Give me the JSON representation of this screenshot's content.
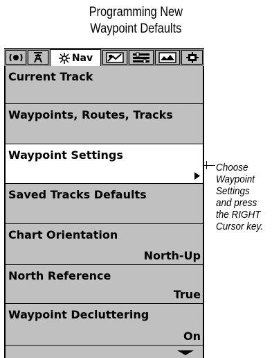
{
  "caption": {
    "line1": "Programming New",
    "line2": "Waypoint Defaults"
  },
  "tabs": [
    {
      "name": "sonar",
      "icon": "sonar-icon",
      "active": false
    },
    {
      "name": "alarms",
      "icon": "alarm-icon",
      "active": false
    },
    {
      "name": "nav",
      "icon": "nav-icon",
      "label": "Nav",
      "active": true
    },
    {
      "name": "chart",
      "icon": "chart-icon",
      "active": false
    },
    {
      "name": "setup",
      "icon": "setup-icon",
      "active": false
    },
    {
      "name": "views",
      "icon": "views-icon",
      "active": false
    },
    {
      "name": "accessories",
      "icon": "accessory-icon",
      "active": false
    }
  ],
  "menu": {
    "items": [
      {
        "label": "Current Track",
        "value": ""
      },
      {
        "label": "Waypoints, Routes, Tracks",
        "value": ""
      },
      {
        "label": "Waypoint Settings",
        "value": "",
        "selected": true
      },
      {
        "label": "Saved Tracks Defaults",
        "value": ""
      },
      {
        "label": "Chart Orientation",
        "value": "North-Up"
      },
      {
        "label": "North Reference",
        "value": "True"
      },
      {
        "label": "Waypoint Decluttering",
        "value": "On"
      }
    ]
  },
  "callout": {
    "lines": [
      "Choose",
      "Waypoint",
      "Settings",
      "and press",
      "the RIGHT",
      "Cursor key."
    ]
  },
  "colors": {
    "menu_bg": "#c0c0c0",
    "selected_bg": "#ffffff",
    "tab_strip": "#8a8a8a"
  }
}
